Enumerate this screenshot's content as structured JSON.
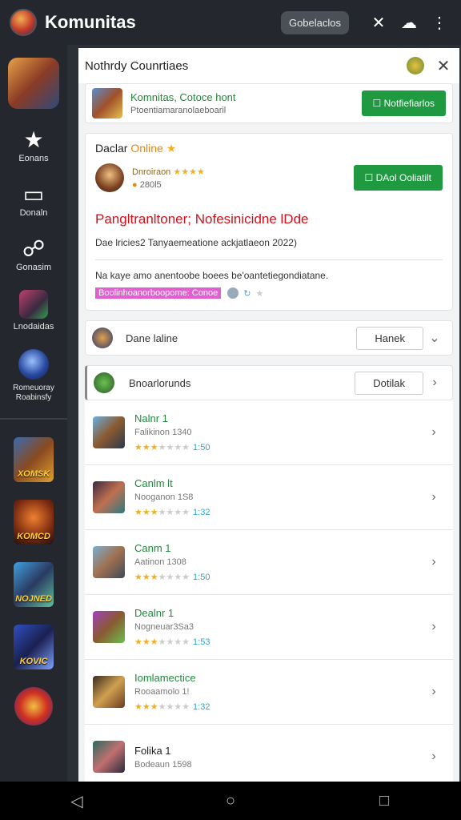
{
  "topbar": {
    "title": "Komunitas",
    "pill": "Gobelaclos",
    "icons": [
      "logo-icon",
      "shuffle-icon",
      "cloud-icon",
      "more-icon"
    ]
  },
  "sidebar": {
    "items": [
      {
        "label": "Eonans",
        "icon": "star-icon"
      },
      {
        "label": "Donaln",
        "icon": "book-icon"
      },
      {
        "label": "Gonasim",
        "icon": "chat-icon"
      },
      {
        "label": "Lnodaidas",
        "icon": "game-icon"
      },
      {
        "label": "Romeuoray Roabinsfy",
        "icon": "globe-icon"
      }
    ],
    "games": [
      "XOMSK",
      "KOMCD",
      "NOJNED",
      "KOVIC",
      ""
    ]
  },
  "panel": {
    "title": "Nothrdy Counrtiaes",
    "banner": {
      "title": "Komnitas, Cotoce hont",
      "subtitle": "Ptoentiamaranolaeboaril",
      "button": "Notfiefiarlos"
    },
    "featured": {
      "heading_a": "Daclar",
      "heading_b": "Online",
      "user_name": "Dnroiraon",
      "user_stars": "★★★★",
      "user_count": "280l5",
      "button": "DAol Ooliatilt",
      "red_title": "Pangltranltoner; Nofesinicidne lDde",
      "desc": "Dae lricies2 Tanyaemeatione ackjatlaeon 2022)",
      "desc2": "Na kaye amo anentoobe boees be'oantetiegondiatane.",
      "tag": "Boolinhoanorboopome: Conoe"
    },
    "row_online": {
      "label": "Dane laline",
      "button": "Hanek"
    },
    "row_boards": {
      "label": "Bnoarlorunds",
      "button": "Dotilak"
    },
    "games": [
      {
        "name": "Nalnr 1",
        "meta": "Falikinon 1340",
        "score": "1:50"
      },
      {
        "name": "Canlm lt",
        "meta": "Nooganon 1S8",
        "score": "1:32"
      },
      {
        "name": "Canm 1",
        "meta": "Aatinon 1308",
        "score": "1:50"
      },
      {
        "name": "Dealnr 1",
        "meta": "Nogneuar3Sa3",
        "score": "1:53"
      },
      {
        "name": "Iomlamectice",
        "meta": "Rooaamolo 1!",
        "score": "1:32"
      },
      {
        "name": "Folika 1",
        "meta": "Bodeaun 1598",
        "score": ""
      }
    ]
  },
  "navbar": {
    "icons": [
      "back-icon",
      "home-icon",
      "recents-icon"
    ]
  }
}
